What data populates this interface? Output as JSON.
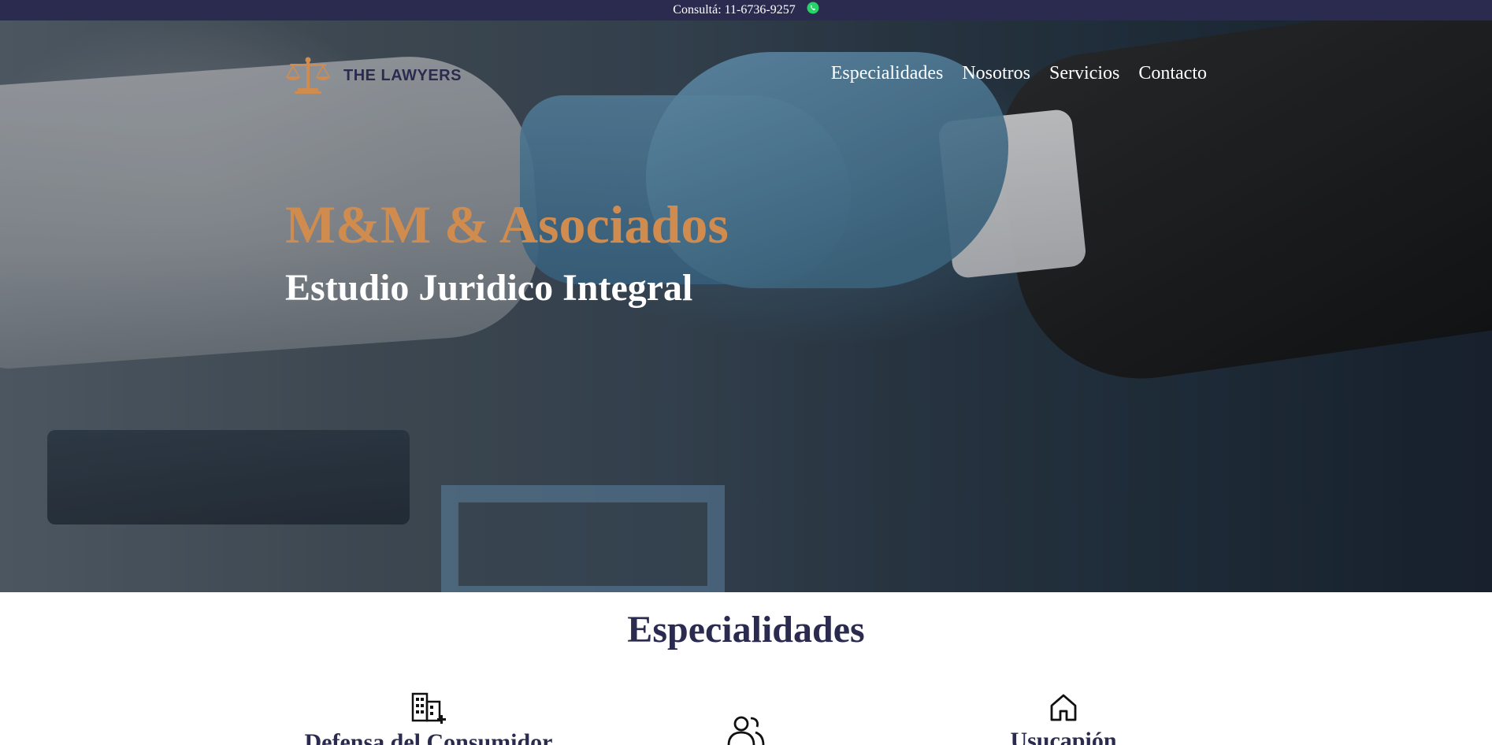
{
  "topbar": {
    "consult_text": "Consultá: 11-6736-9257",
    "whatsapp_icon": "whatsapp-icon",
    "background": "#2b2b4f"
  },
  "nav": {
    "logo_text": "THE LAWYERS",
    "logo_icon": "scales-icon",
    "links": [
      "Especialidades",
      "Nosotros",
      "Servicios",
      "Contacto"
    ]
  },
  "hero": {
    "title": "M&M & Asociados",
    "subtitle": "Estudio Juridico Integral",
    "title_color": "#d08c4f"
  },
  "specialties": {
    "heading": "Especialidades",
    "items": [
      {
        "label": "Defensa del Consumidor",
        "icon": "building-add-icon"
      },
      {
        "label": "",
        "icon": "people-icon"
      },
      {
        "label": "Usucapión",
        "icon": "house-icon"
      }
    ]
  },
  "colors": {
    "primary": "#2b2b4f",
    "accent": "#d08c4f"
  }
}
